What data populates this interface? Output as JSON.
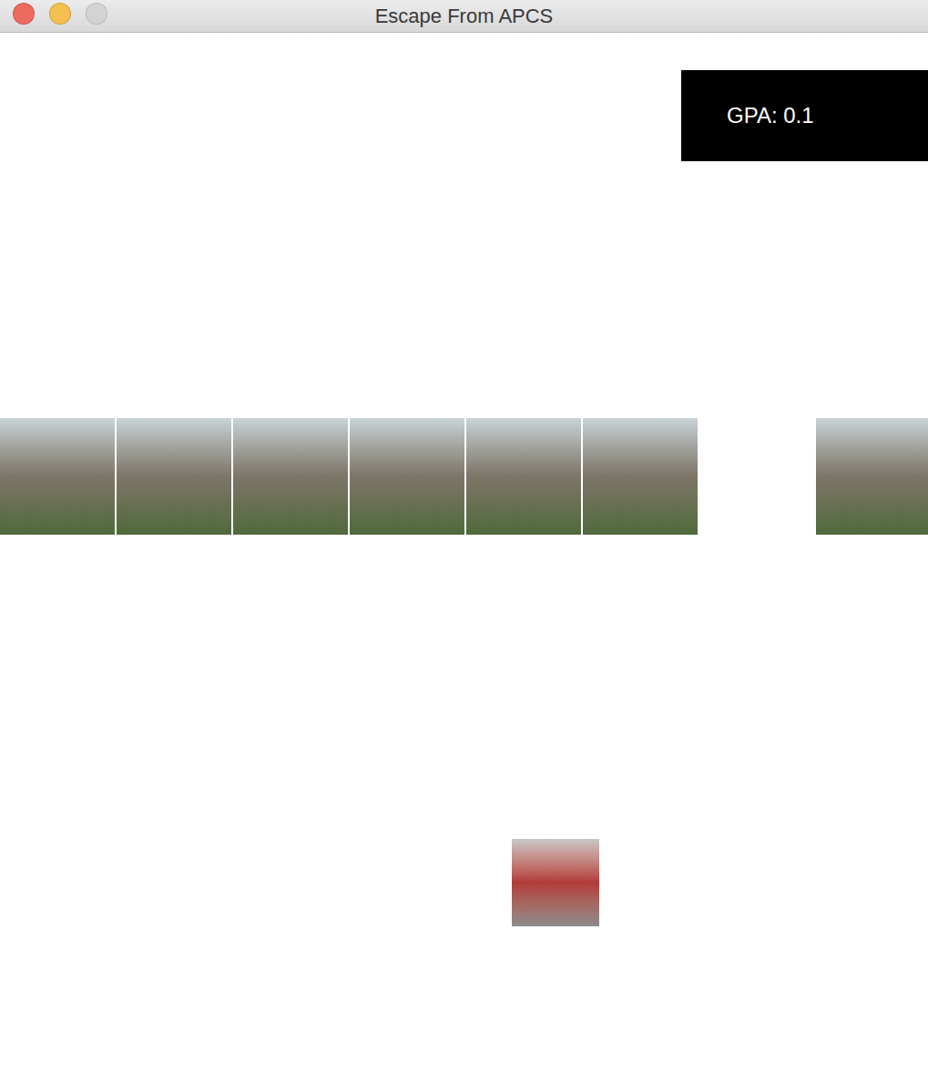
{
  "window": {
    "title": "Escape From APCS",
    "buttons": [
      {
        "kind": "close",
        "disabled": false,
        "color": "#ed6a5e"
      },
      {
        "kind": "minimize",
        "disabled": false,
        "color": "#f5bf4f"
      },
      {
        "kind": "zoom",
        "disabled": true,
        "color": "#d0d0d0"
      }
    ]
  },
  "hud": {
    "gpa": "GPA: 0.1"
  },
  "obstacles": [
    {
      "present": true
    },
    {
      "present": true
    },
    {
      "present": true
    },
    {
      "present": true
    },
    {
      "present": true
    },
    {
      "present": true
    },
    {
      "present": false
    },
    {
      "present": true
    }
  ],
  "player": {
    "visible": true
  }
}
